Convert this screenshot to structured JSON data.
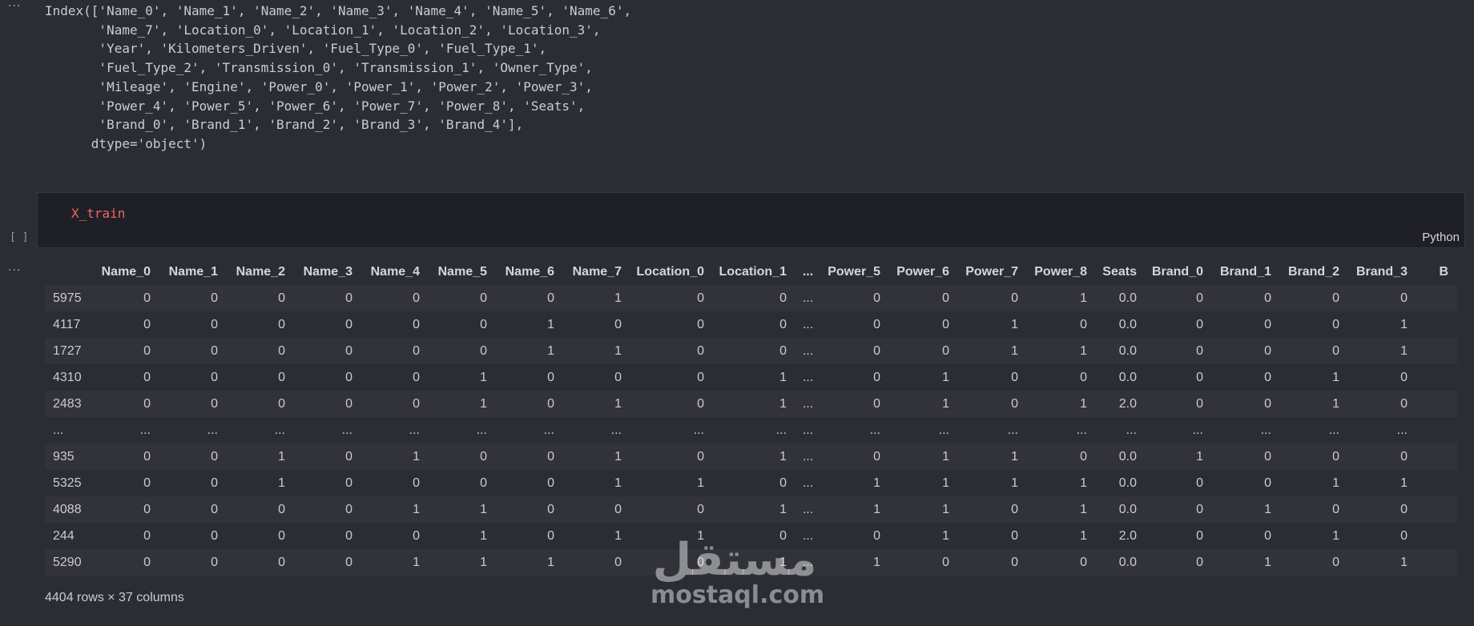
{
  "gutter": {
    "menu_glyph": "···",
    "exec_count": "[ ]"
  },
  "output_index": {
    "lines": [
      "Index(['Name_0', 'Name_1', 'Name_2', 'Name_3', 'Name_4', 'Name_5', 'Name_6',",
      "       'Name_7', 'Location_0', 'Location_1', 'Location_2', 'Location_3',",
      "       'Year', 'Kilometers_Driven', 'Fuel_Type_0', 'Fuel_Type_1',",
      "       'Fuel_Type_2', 'Transmission_0', 'Transmission_1', 'Owner_Type',",
      "       'Mileage', 'Engine', 'Power_0', 'Power_1', 'Power_2', 'Power_3',",
      "       'Power_4', 'Power_5', 'Power_6', 'Power_7', 'Power_8', 'Seats',",
      "       'Brand_0', 'Brand_1', 'Brand_2', 'Brand_3', 'Brand_4'],",
      "      dtype='object')"
    ]
  },
  "code_cell": {
    "code": "X_train",
    "language": "Python"
  },
  "dataframe": {
    "columns": [
      "",
      "Name_0",
      "Name_1",
      "Name_2",
      "Name_3",
      "Name_4",
      "Name_5",
      "Name_6",
      "Name_7",
      "Location_0",
      "Location_1",
      "...",
      "Power_5",
      "Power_6",
      "Power_7",
      "Power_8",
      "Seats",
      "Brand_0",
      "Brand_1",
      "Brand_2",
      "Brand_3",
      "B"
    ],
    "rows": [
      [
        "5975",
        "0",
        "0",
        "0",
        "0",
        "0",
        "0",
        "0",
        "1",
        "0",
        "0",
        "...",
        "0",
        "0",
        "0",
        "1",
        "0.0",
        "0",
        "0",
        "0",
        "0",
        ""
      ],
      [
        "4117",
        "0",
        "0",
        "0",
        "0",
        "0",
        "0",
        "1",
        "0",
        "0",
        "0",
        "...",
        "0",
        "0",
        "1",
        "0",
        "0.0",
        "0",
        "0",
        "0",
        "1",
        ""
      ],
      [
        "1727",
        "0",
        "0",
        "0",
        "0",
        "0",
        "0",
        "1",
        "1",
        "0",
        "0",
        "...",
        "0",
        "0",
        "1",
        "1",
        "0.0",
        "0",
        "0",
        "0",
        "1",
        ""
      ],
      [
        "4310",
        "0",
        "0",
        "0",
        "0",
        "0",
        "1",
        "0",
        "0",
        "0",
        "1",
        "...",
        "0",
        "1",
        "0",
        "0",
        "0.0",
        "0",
        "0",
        "1",
        "0",
        ""
      ],
      [
        "2483",
        "0",
        "0",
        "0",
        "0",
        "0",
        "1",
        "0",
        "1",
        "0",
        "1",
        "...",
        "0",
        "1",
        "0",
        "1",
        "2.0",
        "0",
        "0",
        "1",
        "0",
        ""
      ],
      [
        "...",
        "...",
        "...",
        "...",
        "...",
        "...",
        "...",
        "...",
        "...",
        "...",
        "...",
        "...",
        "...",
        "...",
        "...",
        "...",
        "...",
        "...",
        "...",
        "...",
        "...",
        ""
      ],
      [
        "935",
        "0",
        "0",
        "1",
        "0",
        "1",
        "0",
        "0",
        "1",
        "0",
        "1",
        "...",
        "0",
        "1",
        "1",
        "0",
        "0.0",
        "1",
        "0",
        "0",
        "0",
        ""
      ],
      [
        "5325",
        "0",
        "0",
        "1",
        "0",
        "0",
        "0",
        "0",
        "1",
        "1",
        "0",
        "...",
        "1",
        "1",
        "1",
        "1",
        "0.0",
        "0",
        "0",
        "1",
        "1",
        ""
      ],
      [
        "4088",
        "0",
        "0",
        "0",
        "0",
        "1",
        "1",
        "0",
        "0",
        "0",
        "1",
        "...",
        "1",
        "1",
        "0",
        "1",
        "0.0",
        "0",
        "1",
        "0",
        "0",
        ""
      ],
      [
        "244",
        "0",
        "0",
        "0",
        "0",
        "0",
        "1",
        "0",
        "1",
        "1",
        "0",
        "...",
        "0",
        "1",
        "0",
        "1",
        "2.0",
        "0",
        "0",
        "1",
        "0",
        ""
      ],
      [
        "5290",
        "0",
        "0",
        "0",
        "0",
        "1",
        "1",
        "1",
        "0",
        "0",
        "1",
        "...",
        "1",
        "0",
        "0",
        "0",
        "0.0",
        "0",
        "1",
        "0",
        "1",
        ""
      ]
    ],
    "summary": "4404 rows × 37 columns"
  },
  "watermark": {
    "logo": "مستقل",
    "text": "mostaql.com"
  },
  "colors": {
    "background": "#2b2d35",
    "cell_background": "#1f2027",
    "code_text": "#f1665d",
    "row_stripe": "#31323a"
  }
}
